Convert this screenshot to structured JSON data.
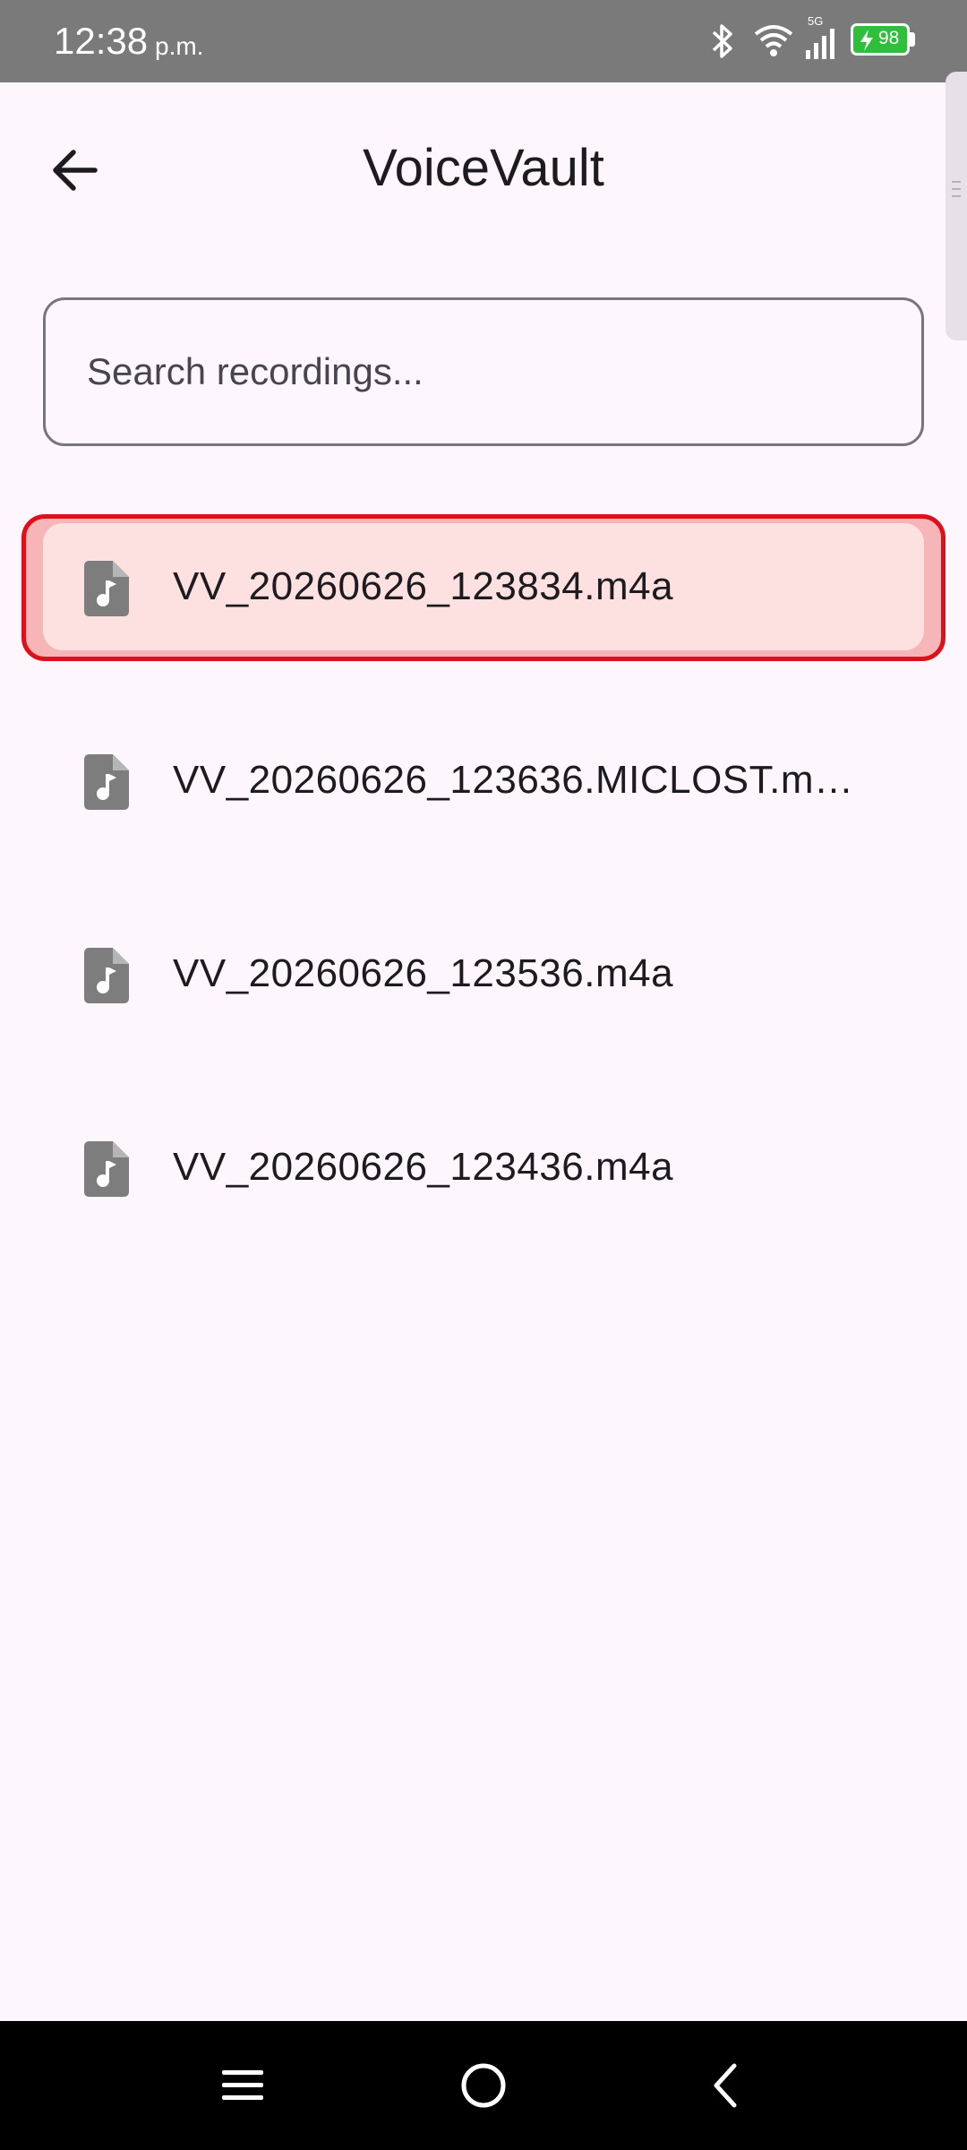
{
  "status_bar": {
    "time": "12:38",
    "ampm": "p.m.",
    "network_label": "5G",
    "battery_level": "98",
    "battery_color": "#2fbf3b",
    "icons": [
      "bluetooth-icon",
      "wifi-icon",
      "signal-icon",
      "battery-icon"
    ]
  },
  "header": {
    "title": "VoiceVault",
    "back_icon": "arrow-left-icon"
  },
  "search": {
    "placeholder": "Search recordings...",
    "value": ""
  },
  "recordings": [
    {
      "name": "VV_20260626_123834.m4a",
      "selected": true,
      "icon": "audio-file-icon"
    },
    {
      "name": "VV_20260626_123636.MICLOST.m…",
      "selected": false,
      "icon": "audio-file-icon"
    },
    {
      "name": "VV_20260626_123536.m4a",
      "selected": false,
      "icon": "audio-file-icon"
    },
    {
      "name": "VV_20260626_123436.m4a",
      "selected": false,
      "icon": "audio-file-icon"
    }
  ],
  "colors": {
    "background": "#fdf7fd",
    "selection_fill": "#fde0e0",
    "selection_border": "#e0101a",
    "icon_gray": "#7d7d7d"
  },
  "nav_bar": {
    "buttons": [
      "menu-icon",
      "home-icon",
      "back-icon"
    ]
  }
}
